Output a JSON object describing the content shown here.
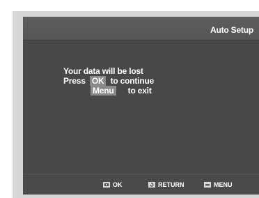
{
  "header": {
    "title": "Auto Setup"
  },
  "message": {
    "line1": "Your data will be lost",
    "line2_prefix": "Press",
    "line2_key": "OK",
    "line2_suffix": "to continue",
    "line3_key": "Menu",
    "line3_suffix": "to exit"
  },
  "footer": {
    "hints": [
      {
        "icon": "ok-icon",
        "label": "OK"
      },
      {
        "icon": "return-icon",
        "label": "RETURN"
      },
      {
        "icon": "menu-icon",
        "label": "MENU"
      }
    ]
  }
}
